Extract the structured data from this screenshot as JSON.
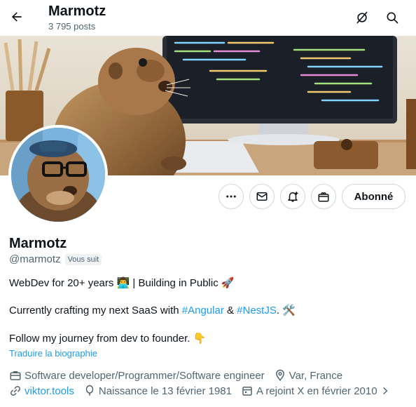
{
  "header": {
    "title": "Marmotz",
    "posts_count": "3 795 posts"
  },
  "actions": {
    "follow_label": "Abonné"
  },
  "profile": {
    "display_name": "Marmotz",
    "handle": "@marmotz",
    "follows_you": "Vous suit",
    "bio": {
      "line1_text": "WebDev for 20+ years ",
      "line1_emoji1": "👨‍💻",
      "line1_rest": " | Building in Public ",
      "line1_emoji2": "🚀",
      "line2_pre": "Currently crafting my next SaaS with ",
      "line2_tag1": "#Angular",
      "line2_mid": " & ",
      "line2_tag2": "#NestJS",
      "line2_post": ". ",
      "line2_emoji": "🛠️",
      "line3_text": "Follow my journey from dev to founder. ",
      "line3_emoji": "👇"
    },
    "translate_label": "Traduire la biographie",
    "meta": {
      "profession": "Software developer/Programmer/Software engineer",
      "location": "Var, France",
      "website": "viktor.tools",
      "birthday": "Naissance le 13 février 1981",
      "joined": "A rejoint X en février 2010"
    }
  },
  "icons": {
    "back": "arrow-left-icon",
    "grok": "grok-icon",
    "search": "search-icon",
    "more": "more-icon",
    "message": "message-icon",
    "notify": "notification-bell-icon",
    "subscribe": "subscription-icon",
    "profession": "briefcase-icon",
    "location": "location-icon",
    "website": "link-icon",
    "birthday": "balloon-icon",
    "joined": "calendar-icon",
    "chevron": "chevron-right-icon"
  },
  "colors": {
    "accent": "#1d9bf0",
    "text_primary": "#0f1419",
    "text_secondary": "#536471",
    "border": "#cfd9de"
  }
}
